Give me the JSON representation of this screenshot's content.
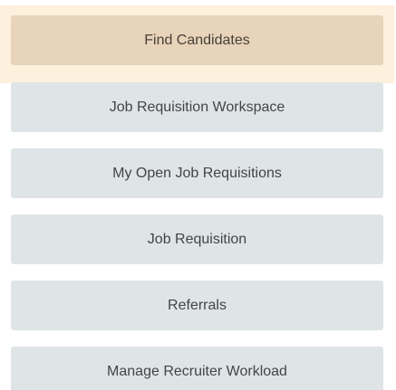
{
  "menu": {
    "items": [
      {
        "label": "Find Candidates",
        "active": true
      },
      {
        "label": "Job Requisition Workspace"
      },
      {
        "label": "My Open Job Requisitions"
      },
      {
        "label": "Job Requisition"
      },
      {
        "label": "Referrals"
      },
      {
        "label": "Manage Recruiter Workload"
      }
    ]
  },
  "colors": {
    "active_item_bg": "#e7d4bb",
    "active_highlight_band": "#fdf0dc",
    "item_bg": "#dfe5e6",
    "text": "#444444"
  }
}
